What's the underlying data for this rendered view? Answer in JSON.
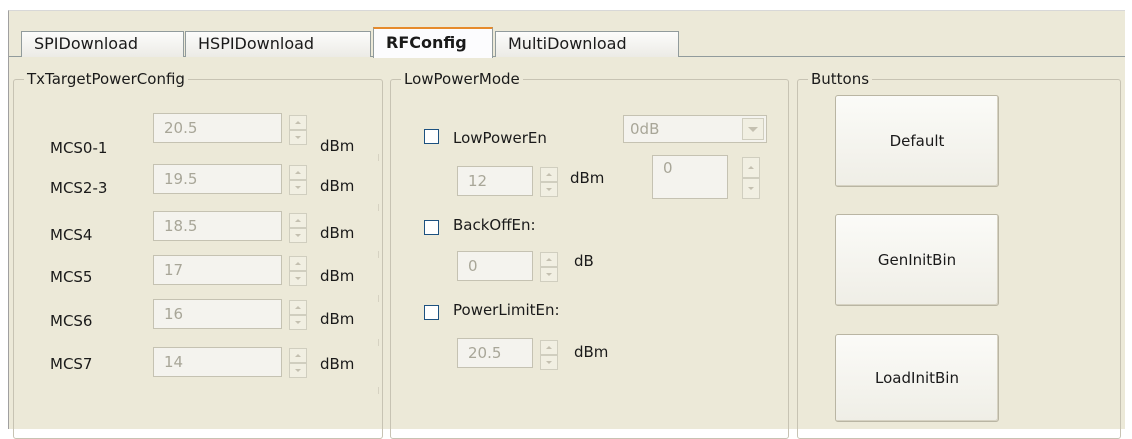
{
  "tabs": [
    {
      "label": "SPIDownload",
      "active": false
    },
    {
      "label": "HSPIDownload",
      "active": false
    },
    {
      "label": "RFConfig",
      "active": true
    },
    {
      "label": "MultiDownload",
      "active": false
    }
  ],
  "tx_group": {
    "title": "TxTargetPowerConfig",
    "rows": [
      {
        "label": "MCS0-1",
        "value": "20.5",
        "unit": "dBm"
      },
      {
        "label": "MCS2-3",
        "value": "19.5",
        "unit": "dBm"
      },
      {
        "label": "MCS4",
        "value": "18.5",
        "unit": "dBm"
      },
      {
        "label": "MCS5",
        "value": "17",
        "unit": "dBm"
      },
      {
        "label": "MCS6",
        "value": "16",
        "unit": "dBm"
      },
      {
        "label": "MCS7",
        "value": "14",
        "unit": "dBm"
      }
    ]
  },
  "lowpower_group": {
    "title": "LowPowerMode",
    "low_power_en": {
      "label": "LowPowerEn",
      "checked": false,
      "select_value": "0dB",
      "value": "12",
      "unit": "dBm",
      "offset_value": "0"
    },
    "back_off_en": {
      "label": "BackOffEn:",
      "checked": false,
      "value": "0",
      "unit": "dB"
    },
    "power_limit_en": {
      "label": "PowerLimitEn:",
      "checked": false,
      "value": "20.5",
      "unit": "dBm"
    }
  },
  "buttons_group": {
    "title": "Buttons",
    "default_label": "Default",
    "gen_init_bin_label": "GenInitBin",
    "load_init_bin_label": "LoadInitBin"
  },
  "colors": {
    "window_bg": "#ece9d8",
    "active_tab_accent": "#e68b2c",
    "checkbox_border": "#1c5180"
  }
}
